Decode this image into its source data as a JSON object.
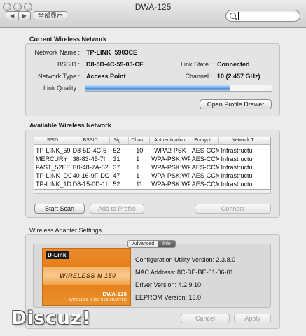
{
  "window": {
    "title": "DWA-125",
    "nav_back": "◀",
    "nav_forward": "▶",
    "show_all": "全部显示",
    "search_placeholder": ""
  },
  "current_network": {
    "section_title": "Current Wireless Network",
    "network_name_label": "Network Name :",
    "network_name": "TP-LINK_5903CE",
    "bssid_label": "BSSID :",
    "bssid": "D8-5D-4C-59-03-CE",
    "link_state_label": "Link State :",
    "link_state": "Connected",
    "network_type_label": "Network Type :",
    "network_type": "Access Point",
    "channel_label": "Channel :",
    "channel": "10 (2.457 GHz)",
    "link_quality_label": "Link Quality :",
    "link_quality_percent": 78,
    "open_profile_button": "Open Profile Drawer"
  },
  "available_networks": {
    "section_title": "Available Wireless Network",
    "columns": [
      "SSID",
      "BSSID",
      "Sig...",
      "Chan...",
      "Authentication",
      "Encrypt...",
      "Network T..."
    ],
    "rows": [
      [
        "TP-LINK_59(",
        "D8-5D-4C-5",
        "52",
        "10",
        "WPA2-PSK",
        "AES-CCM",
        "Infrastructu"
      ],
      [
        "MERCURY_7",
        "38-83-45-7!",
        "31",
        "1",
        "WPA-PSK;WP.",
        "AES-CCM",
        "Infrastructu"
      ],
      [
        "FAST_52EEA",
        "B0-48-7A-52",
        "37",
        "1",
        "WPA-PSK;WP.",
        "AES-CCM",
        "Infrastructu"
      ],
      [
        "TP-LINK_DC",
        "40-16-9F-DC",
        "47",
        "1",
        "WPA-PSK;WP.",
        "AES-CCM",
        "Infrastructu"
      ],
      [
        "TP-LINK_1D",
        "D8-15-0D-1I",
        "52",
        "11",
        "WPA-PSK;WP.",
        "AES-CCM",
        "Infrastructu"
      ]
    ],
    "start_scan_button": "Start Scan",
    "add_to_profile_button": "Add to Profile",
    "connect_button": "Connect"
  },
  "adapter_settings": {
    "section_title": "Wireless Adapter Settings",
    "tabs": [
      "Advanced",
      "Info"
    ],
    "active_tab": "Info",
    "card": {
      "logo": "D-Link",
      "product_line": "WIRELESS N 150",
      "model": "DWA-125",
      "subtitle": "WIRELESS N 150 USB ADAPTER"
    },
    "config_utility_version": "Configuration Utility Version:  2.3.8.0",
    "mac_address": "MAC Address:   8C-BE-BE-01-06-01",
    "driver_version": "Driver Version:   4.2.9.10",
    "eeprom_version": "EEPROM Version:   13.0",
    "cancel_button": "Cancel",
    "apply_button": "Apply"
  },
  "watermark": "Discuz!"
}
